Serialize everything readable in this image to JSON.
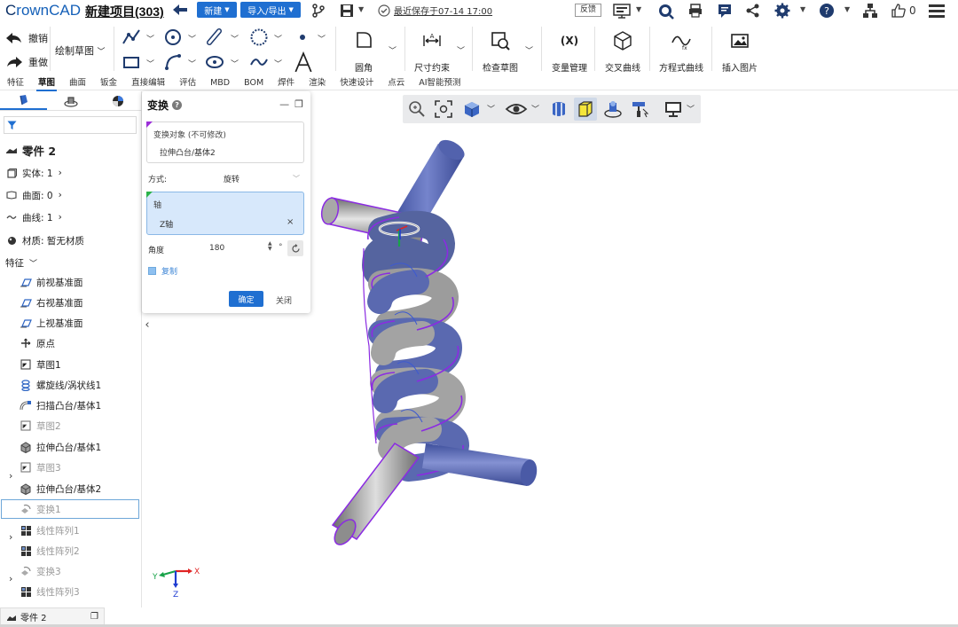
{
  "app": {
    "logo_prefix": "C",
    "logo_rest": "rownCAD",
    "project_title": "新建项目(303)",
    "new_button": "新建",
    "import_export_button": "导入/导出",
    "saved_text": "最近保存于07-14 17:00",
    "feedback": "反馈",
    "like_count": "0"
  },
  "ribbon": {
    "undo": "撤销",
    "redo": "重做",
    "sketch_dropdown": "绘制草图",
    "fillet": "圆角",
    "dimension": "尺寸约束",
    "check_sketch": "检查草图",
    "variable_label": "(X)",
    "variable_manage": "变量管理",
    "intersection_curve": "交叉曲线",
    "equation_curve": "方程式曲线",
    "insert_image": "插入图片"
  },
  "tabs": [
    "特征",
    "草图",
    "曲面",
    "钣金",
    "直接编辑",
    "评估",
    "MBD",
    "BOM",
    "焊件",
    "渲染",
    "快速设计",
    "点云",
    "AI智能预测"
  ],
  "active_tab": "草图",
  "tree": {
    "part": "零件 2",
    "solid": "实体: 1",
    "surface": "曲面: 0",
    "curve": "曲线: 1",
    "material": "材质: 暂无材质",
    "features_header": "特征",
    "items": [
      {
        "label": "前视基准面"
      },
      {
        "label": "右视基准面"
      },
      {
        "label": "上视基准面"
      },
      {
        "label": "原点"
      },
      {
        "label": "草图1"
      },
      {
        "label": "螺旋线/涡状线1"
      },
      {
        "label": "扫描凸台/基体1"
      },
      {
        "label": "草图2"
      },
      {
        "label": "拉伸凸台/基体1"
      },
      {
        "label": "草图3"
      },
      {
        "label": "拉伸凸台/基体2"
      },
      {
        "label": "变换1"
      },
      {
        "label": "线性阵列1"
      },
      {
        "label": "线性阵列2"
      },
      {
        "label": "变换3"
      },
      {
        "label": "线性阵列3"
      }
    ]
  },
  "bottom_tab": "零件 2",
  "dialog": {
    "title": "变换",
    "help": "?",
    "target_label": "变换对象 (不可修改)",
    "target_value": "拉伸凸台/基体2",
    "mode_label": "方式:",
    "mode_value": "旋转",
    "axis_label": "轴",
    "axis_value": "Z轴",
    "axis_clear": "×",
    "angle_label": "角度",
    "angle_value": "180",
    "angle_unit": "°",
    "copy_label": "复制",
    "confirm": "确定",
    "close": "关闭"
  },
  "triad": {
    "x": "X",
    "y": "Y",
    "z": "Z"
  },
  "colors": {
    "accent": "#1f6fd1",
    "tube_blue": "#5b6bb4",
    "tube_grey": "#9c9c9c",
    "highlight": "#8b2be2"
  }
}
